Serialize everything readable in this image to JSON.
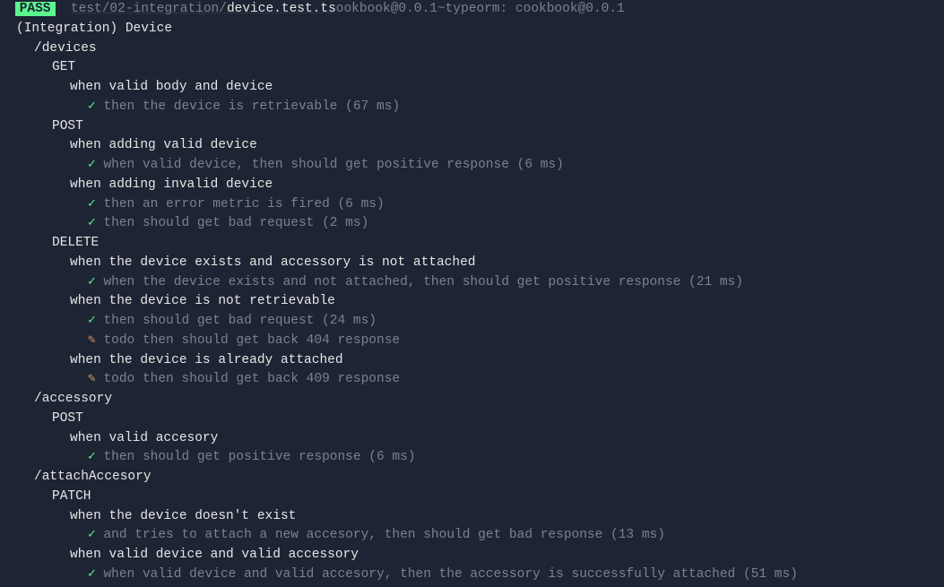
{
  "header": {
    "badge": "PASS",
    "path_prefix": "test/02-integration/",
    "filename": "device.test.ts",
    "trailing": "ookbook@0.0.1~typeorm: cookbook@0.0.1"
  },
  "root_suite": "(Integration) Device",
  "routes": {
    "devices": {
      "label": "/devices",
      "get": {
        "label": "GET",
        "group1": {
          "desc": "when valid body and device",
          "tests": [
            {
              "status": "pass",
              "text": "then the device is retrievable (67 ms)"
            }
          ]
        }
      },
      "post": {
        "label": "POST",
        "group1": {
          "desc": "when adding valid device",
          "tests": [
            {
              "status": "pass",
              "text": "when valid device, then should get positive response (6 ms)"
            }
          ]
        },
        "group2": {
          "desc": "when adding invalid device",
          "tests": [
            {
              "status": "pass",
              "text": "then an error metric is fired (6 ms)"
            },
            {
              "status": "pass",
              "text": "then should get bad request (2 ms)"
            }
          ]
        }
      },
      "delete": {
        "label": "DELETE",
        "group1": {
          "desc": "when the device exists and accessory is not attached",
          "tests": [
            {
              "status": "pass",
              "text": "when the device exists and not attached, then should get positive response (21 ms)"
            }
          ]
        },
        "group2": {
          "desc": "when the device is not retrievable",
          "tests": [
            {
              "status": "pass",
              "text": "then should get bad request (24 ms)"
            },
            {
              "status": "todo",
              "text": "todo then should get back 404 response"
            }
          ]
        },
        "group3": {
          "desc": "when the device is already attached",
          "tests": [
            {
              "status": "todo",
              "text": "todo then should get back 409 response"
            }
          ]
        }
      }
    },
    "accessory": {
      "label": "/accessory",
      "post": {
        "label": "POST",
        "group1": {
          "desc": "when valid accesory",
          "tests": [
            {
              "status": "pass",
              "text": "then should get positive response (6 ms)"
            }
          ]
        }
      }
    },
    "attachAccessory": {
      "label": "/attachAccesory",
      "patch": {
        "label": "PATCH",
        "group1": {
          "desc": "when the device doesn't exist",
          "tests": [
            {
              "status": "pass",
              "text": "and tries to attach a new accesory, then should get bad response (13 ms)"
            }
          ]
        },
        "group2": {
          "desc": "when valid device and valid accessory",
          "tests": [
            {
              "status": "pass",
              "text": "when valid device and valid accesory, then the accessory is successfully attached (51 ms)"
            }
          ]
        }
      }
    }
  },
  "icons": {
    "check": "✓",
    "pencil": "✎"
  }
}
